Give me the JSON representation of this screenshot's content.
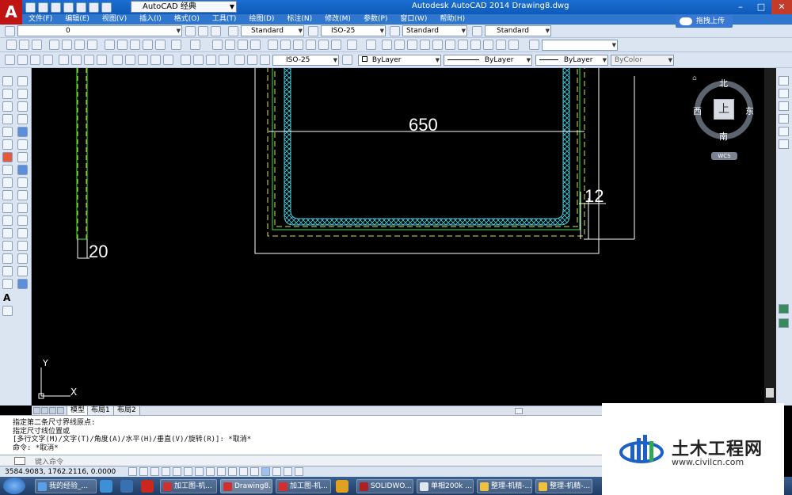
{
  "window": {
    "app_title": "Autodesk AutoCAD 2014    Drawing8.dwg",
    "workspace": "AutoCAD 经典"
  },
  "menu": [
    "文件(F)",
    "编辑(E)",
    "视图(V)",
    "插入(I)",
    "格式(O)",
    "工具(T)",
    "绘图(D)",
    "标注(N)",
    "修改(M)",
    "参数(P)",
    "窗口(W)",
    "帮助(H)"
  ],
  "baidu": {
    "label": "拖拽上传"
  },
  "toolbar1": {
    "layer_value": "0",
    "text_style": "Standard",
    "dim_style": "ISO-25",
    "table_style": "Standard",
    "multileader_style": "Standard"
  },
  "toolbar3": {
    "dim_style": "ISO-25",
    "color": "ByLayer",
    "linetype": "ByLayer",
    "lineweight": "ByLayer",
    "plot_style": "ByColor"
  },
  "drawing": {
    "dim_650": "650",
    "dim_12": "12",
    "dim_20": "20",
    "ucs_y": "Y",
    "ucs_x": "X"
  },
  "viewcube": {
    "north": "北",
    "south": "南",
    "east": "东",
    "west": "西",
    "top": "上",
    "wcs": "WCS"
  },
  "tabs": [
    "模型",
    "布局1",
    "布局2"
  ],
  "command": {
    "history": [
      "指定第二条尺寸界线原点:",
      "指定尺寸线位置或",
      "[多行文字(M)/文字(T)/角度(A)/水平(H)/垂直(V)/旋转(R)]: *取消*",
      "命令: *取消*"
    ],
    "input_placeholder": "键入命令"
  },
  "status": {
    "coords": "3584.9083,  1762.2116,  0.0000"
  },
  "taskbar": {
    "tasks": [
      "我的经验_...",
      "",
      "加工图-机...",
      "Drawing8....",
      "加工图-机...",
      "",
      "SOLIDWO...",
      "单相200k ...",
      "整理-机精-...",
      "整理-机精-..."
    ]
  },
  "watermark": {
    "cn": "土木工程网",
    "url": "www.civilcn.com"
  },
  "colors": {
    "canvas": "#000000",
    "green_line": "#30c830",
    "yellow_dash": "#e0e040",
    "cyan_hatch": "#40d0e0",
    "dim_line": "#ffffff"
  }
}
